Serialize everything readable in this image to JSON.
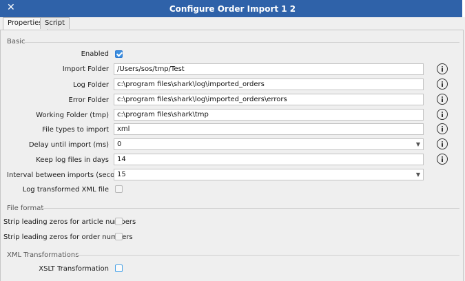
{
  "window": {
    "title": "Configure Order Import 1 2",
    "close": "✕"
  },
  "tabs": [
    {
      "label": "Properties"
    },
    {
      "label": "Script"
    }
  ],
  "sections": {
    "basic": "Basic",
    "file_format": "File format",
    "xml": "XML Transformations"
  },
  "basic": {
    "enabled": {
      "label": "Enabled",
      "checked": true
    },
    "import_folder": {
      "label": "Import Folder",
      "value": "/Users/sos/tmp/Test"
    },
    "log_folder": {
      "label": "Log Folder",
      "value": "c:\\program files\\shark\\log\\imported_orders"
    },
    "error_folder": {
      "label": "Error Folder",
      "value": "c:\\program files\\shark\\log\\imported_orders\\errors"
    },
    "working_folder": {
      "label": "Working Folder (tmp)",
      "value": "c:\\program files\\shark\\tmp"
    },
    "file_types": {
      "label": "File types to import",
      "value": "xml"
    },
    "delay": {
      "label": "Delay until import (ms)",
      "value": "0"
    },
    "keep_logs": {
      "label": "Keep log files in days",
      "value": "14"
    },
    "interval": {
      "label": "Interval between imports (seconds)",
      "value": "15"
    },
    "log_xml": {
      "label": "Log transformed XML file",
      "checked": false
    }
  },
  "file_format": {
    "strip_article": {
      "label": "Strip leading zeros for article numbers",
      "checked": false
    },
    "strip_order": {
      "label": "Strip leading zeros for order numbers",
      "checked": false
    }
  },
  "xml": {
    "xslt": {
      "label": "XSLT Transformation",
      "checked": false
    }
  },
  "icons": {
    "info": "info-icon",
    "dropdown": "chevron-down-icon",
    "check": "checkmark-icon"
  },
  "colors": {
    "titlebar": "#2f62a9",
    "checkbox_checked": "#3b8fe0",
    "focus": "#4aa3e8"
  }
}
